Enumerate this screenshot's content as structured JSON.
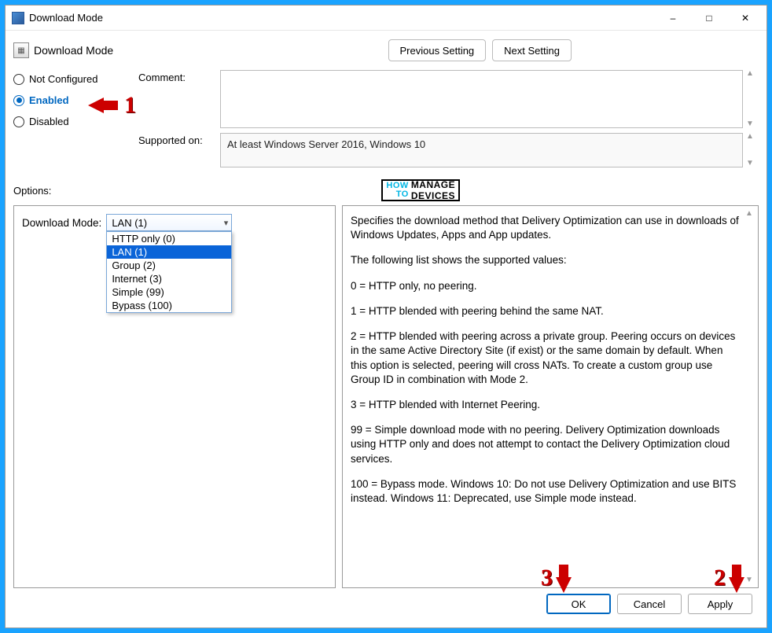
{
  "titlebar": {
    "title": "Download Mode"
  },
  "header": {
    "title": "Download Mode",
    "prev": "Previous Setting",
    "next": "Next Setting"
  },
  "radios": {
    "not_configured": "Not Configured",
    "enabled": "Enabled",
    "disabled": "Disabled",
    "selected": "enabled"
  },
  "labels": {
    "comment": "Comment:",
    "supported": "Supported on:",
    "options": "Options:",
    "download_mode": "Download Mode:"
  },
  "comment_value": "",
  "supported_value": "At least Windows Server 2016, Windows 10",
  "download_mode": {
    "selected": "LAN (1)",
    "options": [
      "HTTP only (0)",
      "LAN (1)",
      "Group (2)",
      "Internet (3)",
      "Simple (99)",
      "Bypass (100)"
    ]
  },
  "logo": {
    "howto": "HOW\nTO",
    "main": "MANAGE\nDEVICES"
  },
  "help": {
    "p1": "Specifies the download method that Delivery Optimization can use in downloads of Windows Updates, Apps and App updates.",
    "p2": "The following list shows the supported values:",
    "p3": "0 = HTTP only, no peering.",
    "p4": "1 = HTTP blended with peering behind the same NAT.",
    "p5": "2 = HTTP blended with peering across a private group. Peering occurs on devices in the same Active Directory Site (if exist) or the same domain by default. When this option is selected, peering will cross NATs. To create a custom group use Group ID in combination with Mode 2.",
    "p6": "3 = HTTP blended with Internet Peering.",
    "p7": "99 = Simple download mode with no peering. Delivery Optimization downloads using HTTP only and does not attempt to contact the Delivery Optimization cloud services.",
    "p8": "100 = Bypass mode. Windows 10: Do not use Delivery Optimization and use BITS instead. Windows 11: Deprecated, use Simple mode instead."
  },
  "buttons": {
    "ok": "OK",
    "cancel": "Cancel",
    "apply": "Apply"
  },
  "annotations": {
    "one": "1",
    "two": "2",
    "three": "3"
  }
}
